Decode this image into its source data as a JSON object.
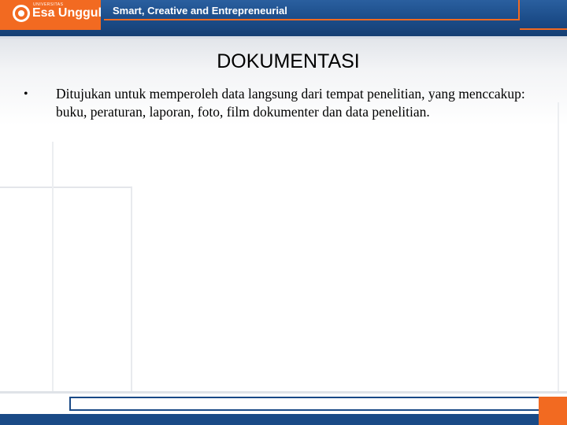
{
  "header": {
    "logo_small_text": "UNIVERSITAS",
    "logo_text": "Esa Unggul",
    "tagline": "Smart, Creative and Entrepreneurial",
    "brand_orange": "#f26a21",
    "brand_blue": "#1a4a86"
  },
  "slide": {
    "title": "DOKUMENTASI",
    "bullets": [
      "Ditujukan untuk memperoleh data langsung dari tempat penelitian, yang menccakup: buku, peraturan, laporan, foto, film dokumenter dan data penelitian."
    ]
  },
  "icons": {
    "bullet": "•",
    "logo": "circle-logo-icon"
  }
}
